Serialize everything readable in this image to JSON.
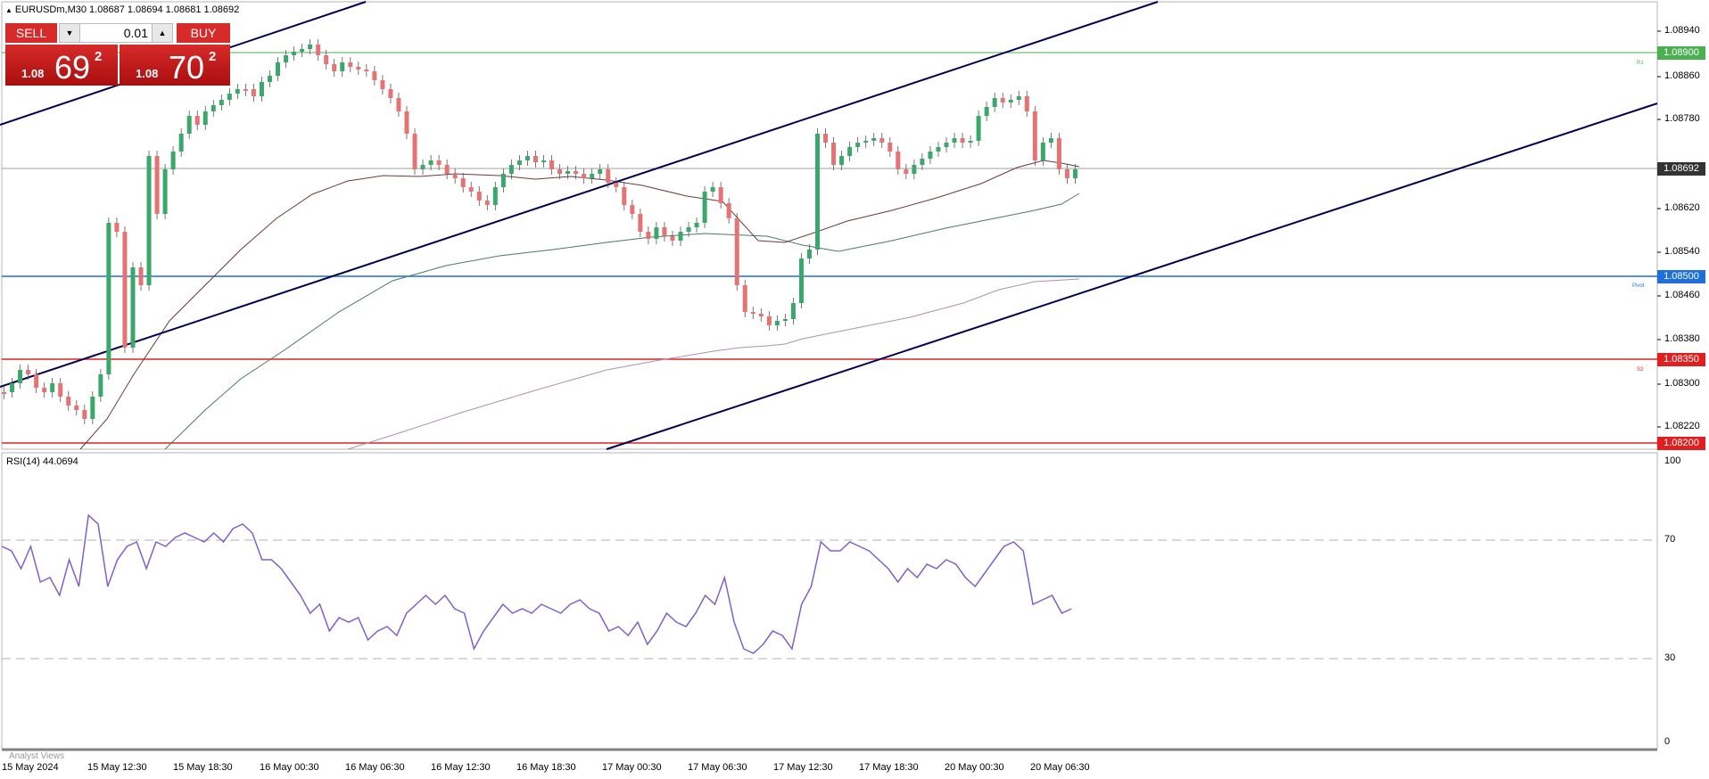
{
  "symbol_header": {
    "text": "EURUSDm,M30  1.08687 1.08694 1.08681 1.08692"
  },
  "trade_panel": {
    "sell_label": "SELL",
    "buy_label": "BUY",
    "volume": "0.01",
    "sell_price_prefix": "1.08",
    "sell_price_big": "69",
    "sell_price_sup": "2",
    "buy_price_prefix": "1.08",
    "buy_price_big": "70",
    "buy_price_sup": "2"
  },
  "price_axis": {
    "labels": [
      "1.08940",
      "1.08860",
      "1.08780",
      "1.08620",
      "1.08540",
      "1.08460",
      "1.08380",
      "1.08300",
      "1.08220"
    ],
    "current_price": "1.08692",
    "levels": [
      {
        "price": "1.08900",
        "color": "#4caf50",
        "tag": "R1"
      },
      {
        "price": "1.08500",
        "color": "#1e6fd9",
        "tag": "Pivot"
      },
      {
        "price": "1.08350",
        "color": "#e02020",
        "tag": "S2"
      },
      {
        "price": "1.08200",
        "color": "#e02020",
        "tag": ""
      }
    ]
  },
  "rsi": {
    "header": "RSI(14) 44.0694",
    "axis_labels": [
      "100",
      "70",
      "30",
      "0"
    ],
    "line_color": "#8060c8"
  },
  "time_axis": {
    "labels": [
      "15 May 2024",
      "15 May 12:30",
      "15 May 18:30",
      "16 May 00:30",
      "16 May 06:30",
      "16 May 12:30",
      "16 May 18:30",
      "17 May 00:30",
      "17 May 06:30",
      "17 May 12:30",
      "17 May 18:30",
      "20 May 00:30",
      "20 May 06:30"
    ]
  },
  "analyst_tab": "Analyst Views",
  "colors": {
    "bull_candle": "#3aa86a",
    "bear_candle": "#e57373",
    "channel": "#000050",
    "ma_fast": "#6d3a3a",
    "ma_mid": "#4a7a60",
    "ma_slow": "#b08fb0"
  }
}
